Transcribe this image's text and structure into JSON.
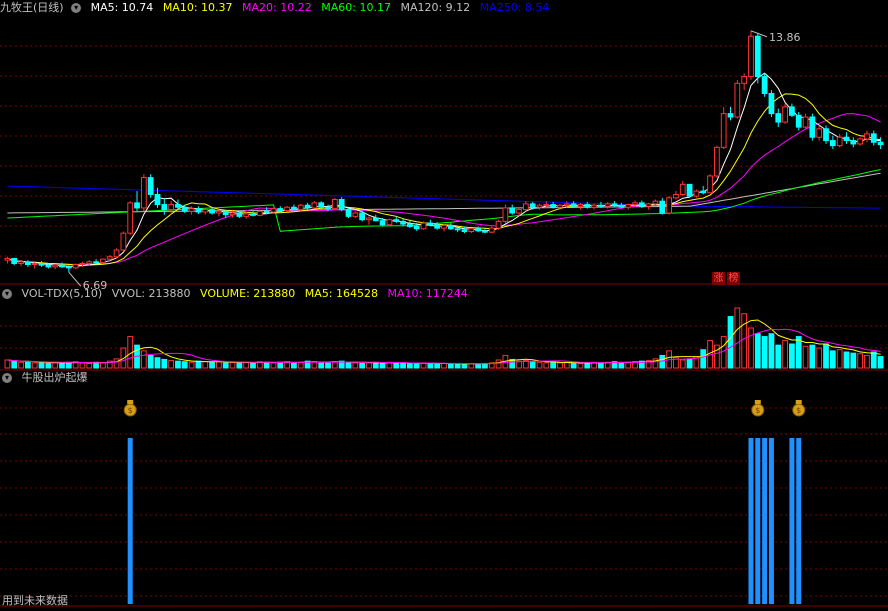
{
  "main_panel": {
    "title": "九牧王(日线)",
    "indicators": [
      {
        "label": "MA5: 10.74",
        "color": "#ffffff"
      },
      {
        "label": "MA10: 10.37",
        "color": "#ffff00"
      },
      {
        "label": "MA20: 10.22",
        "color": "#ff00ff"
      },
      {
        "label": "MA60: 10.17",
        "color": "#00ff00"
      },
      {
        "label": "MA120: 9.12",
        "color": "#c0c0c0"
      },
      {
        "label": "MA250: 8.54",
        "color": "#0000ff"
      }
    ],
    "high_label": "13.86",
    "low_label": "6.69",
    "tags": [
      "涨",
      "榜"
    ]
  },
  "volume_panel": {
    "title": "VOL-TDX(5,10)",
    "indicators": [
      {
        "label": "VVOL: 213880",
        "color": "#c0c0c0"
      },
      {
        "label": "VOLUME: 213880",
        "color": "#ffff00"
      },
      {
        "label": "MA5: 164528",
        "color": "#ffff00"
      },
      {
        "label": "MA10: 117244",
        "color": "#ff00ff"
      }
    ]
  },
  "signal_panel": {
    "title": "牛股出炉起爆"
  },
  "footer_text": "用到未来数据",
  "colors": {
    "up": "#ff3232",
    "down": "#00ffff",
    "grid": "#800000",
    "ma5": "#ffffff",
    "ma10": "#ffff00",
    "ma20": "#ff00ff",
    "ma60": "#00ff00",
    "ma120": "#c0c0c0",
    "ma250": "#0000ff",
    "signal": "#1e90ff"
  },
  "chart_data": {
    "type": "candlestick",
    "price_range": [
      6.4,
      14.3
    ],
    "candles": [
      [
        7.05,
        7.15,
        6.95,
        7.1
      ],
      [
        7.1,
        7.12,
        6.9,
        6.95
      ],
      [
        6.95,
        7.05,
        6.88,
        7.0
      ],
      [
        7.0,
        7.05,
        6.85,
        6.92
      ],
      [
        6.92,
        7.0,
        6.8,
        6.95
      ],
      [
        6.95,
        7.02,
        6.85,
        6.9
      ],
      [
        6.9,
        6.95,
        6.8,
        6.85
      ],
      [
        6.85,
        6.92,
        6.78,
        6.9
      ],
      [
        6.9,
        6.98,
        6.82,
        6.85
      ],
      [
        6.85,
        6.9,
        6.69,
        6.82
      ],
      [
        6.82,
        6.95,
        6.78,
        6.92
      ],
      [
        6.92,
        7.0,
        6.85,
        6.95
      ],
      [
        6.95,
        7.05,
        6.9,
        7.0
      ],
      [
        7.0,
        7.08,
        6.92,
        6.98
      ],
      [
        6.98,
        7.1,
        6.95,
        7.08
      ],
      [
        7.08,
        7.2,
        7.0,
        7.15
      ],
      [
        7.15,
        7.4,
        7.1,
        7.35
      ],
      [
        7.35,
        7.9,
        7.3,
        7.85
      ],
      [
        7.85,
        8.8,
        7.8,
        8.75
      ],
      [
        8.75,
        9.1,
        8.5,
        8.6
      ],
      [
        8.6,
        9.6,
        8.5,
        9.5
      ],
      [
        9.5,
        9.6,
        8.9,
        9.0
      ],
      [
        9.0,
        9.2,
        8.6,
        8.7
      ],
      [
        8.7,
        8.9,
        8.4,
        8.55
      ],
      [
        8.55,
        8.8,
        8.4,
        8.7
      ],
      [
        8.7,
        8.85,
        8.55,
        8.62
      ],
      [
        8.62,
        8.7,
        8.45,
        8.5
      ],
      [
        8.5,
        8.65,
        8.4,
        8.58
      ],
      [
        8.58,
        8.65,
        8.42,
        8.48
      ],
      [
        8.48,
        8.6,
        8.4,
        8.55
      ],
      [
        8.55,
        8.62,
        8.4,
        8.45
      ],
      [
        8.45,
        8.55,
        8.35,
        8.5
      ],
      [
        8.5,
        8.55,
        8.3,
        8.4
      ],
      [
        8.4,
        8.52,
        8.32,
        8.45
      ],
      [
        8.45,
        8.5,
        8.3,
        8.35
      ],
      [
        8.35,
        8.48,
        8.28,
        8.42
      ],
      [
        8.42,
        8.5,
        8.35,
        8.38
      ],
      [
        8.38,
        8.55,
        8.35,
        8.5
      ],
      [
        8.5,
        8.62,
        8.42,
        8.48
      ],
      [
        8.48,
        8.6,
        8.45,
        8.58
      ],
      [
        8.58,
        8.65,
        8.48,
        8.52
      ],
      [
        8.52,
        8.66,
        8.5,
        8.62
      ],
      [
        8.62,
        8.7,
        8.52,
        8.55
      ],
      [
        8.55,
        8.72,
        8.5,
        8.68
      ],
      [
        8.68,
        8.75,
        8.55,
        8.6
      ],
      [
        8.6,
        8.8,
        8.58,
        8.75
      ],
      [
        8.75,
        8.8,
        8.55,
        8.62
      ],
      [
        8.62,
        8.7,
        8.5,
        8.58
      ],
      [
        8.58,
        8.9,
        8.55,
        8.85
      ],
      [
        8.85,
        8.92,
        8.5,
        8.55
      ],
      [
        8.55,
        8.6,
        8.3,
        8.35
      ],
      [
        8.35,
        8.5,
        8.3,
        8.45
      ],
      [
        8.45,
        8.52,
        8.2,
        8.25
      ],
      [
        8.25,
        8.35,
        8.1,
        8.3
      ],
      [
        8.3,
        8.4,
        8.2,
        8.22
      ],
      [
        8.22,
        8.3,
        8.05,
        8.1
      ],
      [
        8.1,
        8.28,
        8.05,
        8.25
      ],
      [
        8.25,
        8.35,
        8.15,
        8.2
      ],
      [
        8.2,
        8.3,
        8.05,
        8.12
      ],
      [
        8.12,
        8.25,
        8.0,
        8.05
      ],
      [
        8.05,
        8.15,
        7.92,
        7.98
      ],
      [
        7.98,
        8.2,
        7.95,
        8.15
      ],
      [
        8.15,
        8.25,
        8.05,
        8.1
      ],
      [
        8.1,
        8.18,
        7.95,
        8.0
      ],
      [
        8.0,
        8.12,
        7.9,
        8.08
      ],
      [
        8.08,
        8.15,
        7.95,
        7.98
      ],
      [
        7.98,
        8.05,
        7.88,
        7.95
      ],
      [
        7.95,
        8.05,
        7.85,
        7.9
      ],
      [
        7.9,
        8.0,
        7.85,
        7.98
      ],
      [
        7.98,
        8.05,
        7.88,
        7.92
      ],
      [
        7.92,
        8.0,
        7.85,
        7.88
      ],
      [
        7.88,
        8.05,
        7.85,
        8.0
      ],
      [
        8.0,
        8.25,
        7.95,
        8.2
      ],
      [
        8.2,
        8.7,
        8.15,
        8.6
      ],
      [
        8.6,
        8.7,
        8.4,
        8.45
      ],
      [
        8.45,
        8.6,
        8.35,
        8.55
      ],
      [
        8.55,
        8.8,
        8.5,
        8.72
      ],
      [
        8.72,
        8.78,
        8.55,
        8.62
      ],
      [
        8.62,
        8.72,
        8.55,
        8.68
      ],
      [
        8.68,
        8.8,
        8.6,
        8.7
      ],
      [
        8.7,
        8.78,
        8.58,
        8.62
      ],
      [
        8.62,
        8.72,
        8.55,
        8.68
      ],
      [
        8.68,
        8.8,
        8.6,
        8.72
      ],
      [
        8.72,
        8.8,
        8.62,
        8.65
      ],
      [
        8.65,
        8.75,
        8.55,
        8.7
      ],
      [
        8.7,
        8.78,
        8.58,
        8.62
      ],
      [
        8.62,
        8.72,
        8.55,
        8.68
      ],
      [
        8.68,
        8.78,
        8.6,
        8.65
      ],
      [
        8.65,
        8.78,
        8.58,
        8.72
      ],
      [
        8.72,
        8.8,
        8.62,
        8.68
      ],
      [
        8.68,
        8.75,
        8.58,
        8.62
      ],
      [
        8.62,
        8.72,
        8.55,
        8.7
      ],
      [
        8.7,
        8.82,
        8.62,
        8.75
      ],
      [
        8.75,
        8.82,
        8.6,
        8.65
      ],
      [
        8.65,
        8.75,
        8.55,
        8.72
      ],
      [
        8.72,
        8.85,
        8.65,
        8.8
      ],
      [
        8.8,
        8.9,
        8.4,
        8.45
      ],
      [
        8.45,
        8.95,
        8.4,
        8.9
      ],
      [
        8.9,
        9.1,
        8.85,
        9.0
      ],
      [
        9.0,
        9.4,
        8.95,
        9.3
      ],
      [
        9.3,
        9.3,
        8.9,
        8.95
      ],
      [
        8.95,
        9.15,
        8.9,
        9.1
      ],
      [
        9.1,
        9.25,
        9.0,
        9.05
      ],
      [
        9.05,
        9.6,
        9.05,
        9.55
      ],
      [
        9.55,
        10.45,
        9.5,
        10.4
      ],
      [
        10.4,
        11.6,
        10.35,
        11.4
      ],
      [
        11.4,
        11.6,
        11.2,
        11.3
      ],
      [
        11.3,
        12.4,
        11.25,
        12.3
      ],
      [
        12.3,
        12.6,
        12.1,
        12.5
      ],
      [
        12.5,
        13.86,
        12.4,
        13.7
      ],
      [
        13.7,
        13.8,
        12.3,
        12.5
      ],
      [
        12.5,
        12.6,
        11.9,
        12.0
      ],
      [
        12.0,
        12.1,
        11.3,
        11.4
      ],
      [
        11.4,
        11.55,
        11.0,
        11.15
      ],
      [
        11.15,
        11.7,
        11.1,
        11.6
      ],
      [
        11.6,
        11.7,
        11.3,
        11.35
      ],
      [
        11.35,
        11.45,
        10.9,
        11.0
      ],
      [
        11.0,
        11.4,
        10.95,
        11.3
      ],
      [
        11.3,
        11.4,
        10.6,
        10.7
      ],
      [
        10.7,
        11.05,
        10.6,
        10.95
      ],
      [
        10.95,
        11.05,
        10.5,
        10.6
      ],
      [
        10.6,
        10.75,
        10.35,
        10.45
      ],
      [
        10.45,
        10.8,
        10.4,
        10.7
      ],
      [
        10.7,
        10.85,
        10.5,
        10.6
      ],
      [
        10.6,
        10.7,
        10.4,
        10.5
      ],
      [
        10.5,
        10.7,
        10.45,
        10.65
      ],
      [
        10.65,
        10.9,
        10.55,
        10.8
      ],
      [
        10.8,
        10.9,
        10.45,
        10.55
      ],
      [
        10.55,
        10.7,
        10.35,
        10.48
      ]
    ],
    "volumes": [
      14,
      12,
      10,
      11,
      9,
      10,
      8,
      9,
      9,
      10,
      11,
      9,
      8,
      10,
      9,
      12,
      16,
      35,
      55,
      40,
      30,
      22,
      18,
      15,
      13,
      12,
      11,
      10,
      12,
      11,
      10,
      11,
      9,
      10,
      9,
      10,
      9,
      11,
      10,
      9,
      10,
      11,
      9,
      10,
      12,
      11,
      10,
      9,
      11,
      12,
      10,
      9,
      8,
      9,
      10,
      9,
      10,
      8,
      9,
      8,
      7,
      9,
      8,
      7,
      8,
      7,
      8,
      7,
      8,
      7,
      8,
      9,
      14,
      22,
      15,
      12,
      13,
      11,
      10,
      9,
      10,
      9,
      10,
      9,
      8,
      9,
      10,
      9,
      10,
      11,
      9,
      10,
      11,
      12,
      13,
      16,
      22,
      30,
      18,
      14,
      16,
      20,
      32,
      48,
      40,
      55,
      90,
      105,
      95,
      70,
      60,
      55,
      60,
      40,
      48,
      42,
      55,
      38,
      40,
      35,
      42,
      30,
      32,
      28,
      26,
      25,
      22,
      28,
      20
    ],
    "signal_days": [
      18,
      109,
      110,
      111,
      112,
      115,
      116
    ],
    "signal_icon_days": [
      18,
      110,
      116
    ]
  }
}
